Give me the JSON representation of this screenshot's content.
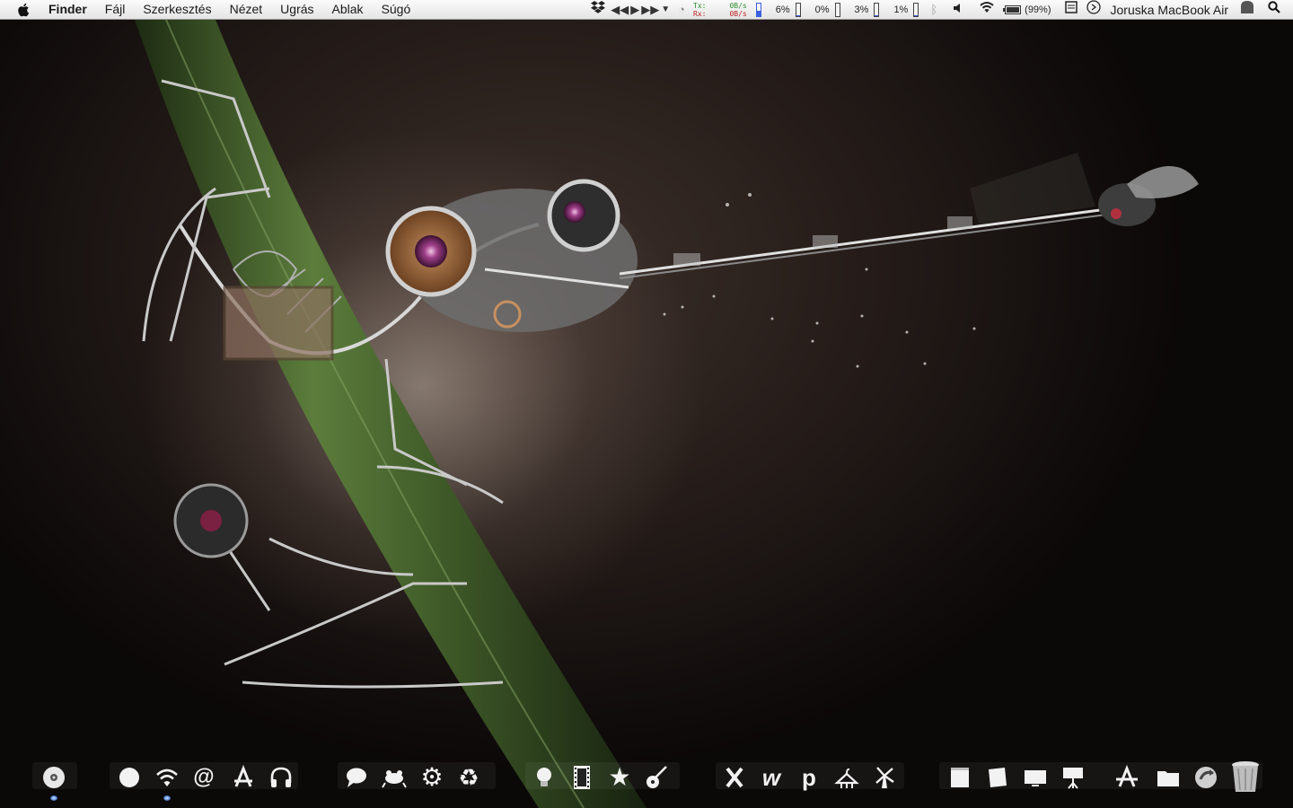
{
  "menubar": {
    "app_name": "Finder",
    "menus": [
      "Fájl",
      "Szerkesztés",
      "Nézet",
      "Ugrás",
      "Ablak",
      "Súgó"
    ],
    "status": {
      "tx_label": "Tx:",
      "rx_label": "Rx:",
      "tx_value": "0B/s",
      "rx_value": "0B/s",
      "meters": [
        {
          "label": "6%",
          "value": 0.06
        },
        {
          "label": "0%",
          "value": 0.0
        },
        {
          "label": "3%",
          "value": 0.03
        },
        {
          "label": "1%",
          "value": 0.01
        }
      ],
      "battery": "(99%)",
      "battery_level": 0.99,
      "user": "Joruska MacBook Air"
    },
    "icons": [
      "apple-icon",
      "dropbox-icon",
      "media-prev-icon",
      "media-play-icon",
      "media-next-icon",
      "media-menu-icon",
      "time-machine-icon",
      "bluetooth-icon",
      "volume-icon",
      "wifi-icon",
      "battery-icon",
      "keyboard-icon",
      "sync-icon",
      "user-icon",
      "spotlight-icon"
    ]
  },
  "dock": {
    "items": [
      {
        "name": "dvd-player-icon",
        "glyph": "◉",
        "running": true
      },
      {
        "name": "circle-app-icon",
        "glyph": "●",
        "running": false
      },
      {
        "name": "wifi-app-icon",
        "glyph": "wifi",
        "running": true
      },
      {
        "name": "mail-at-icon",
        "glyph": "@",
        "running": false
      },
      {
        "name": "app-store-icon",
        "glyph": "A",
        "running": false
      },
      {
        "name": "headphones-icon",
        "glyph": "🎧",
        "running": false
      },
      {
        "name": "chat-bubble-icon",
        "glyph": "bubble",
        "running": false
      },
      {
        "name": "frog-icon",
        "glyph": "frog",
        "running": false
      },
      {
        "name": "gear-icon",
        "glyph": "⚙",
        "running": false
      },
      {
        "name": "recycle-icon",
        "glyph": "♻",
        "running": false
      },
      {
        "name": "lightbulb-icon",
        "glyph": "bulb",
        "running": false
      },
      {
        "name": "film-strip-icon",
        "glyph": "film",
        "running": false
      },
      {
        "name": "star-icon",
        "glyph": "★",
        "running": false
      },
      {
        "name": "guitar-icon",
        "glyph": "guitar",
        "running": false
      },
      {
        "name": "bug-icon",
        "glyph": "bug",
        "running": false
      },
      {
        "name": "w-letter-icon",
        "glyph": "w",
        "running": false
      },
      {
        "name": "p-letter-icon",
        "glyph": "p",
        "running": false
      },
      {
        "name": "hanger-icon",
        "glyph": "hanger",
        "running": false
      },
      {
        "name": "windmill-icon",
        "glyph": "mill",
        "running": false
      },
      {
        "name": "notepad-icon",
        "glyph": "pad",
        "running": false
      },
      {
        "name": "sticky-note-icon",
        "glyph": "note",
        "running": false
      },
      {
        "name": "monitor-icon",
        "glyph": "screen",
        "running": false
      },
      {
        "name": "presentation-icon",
        "glyph": "pres",
        "running": false
      },
      {
        "name": "applications-folder-icon",
        "glyph": "A",
        "running": false
      },
      {
        "name": "folder-icon",
        "glyph": "folder",
        "running": false
      },
      {
        "name": "downloads-stack-icon",
        "glyph": "swirl",
        "running": false
      },
      {
        "name": "trash-icon",
        "glyph": "trash",
        "running": false
      }
    ]
  },
  "colors": {
    "menubar_top": "#fbfbfb",
    "menubar_bottom": "#e4e4e4",
    "stem_green": "#4e6f34",
    "tx_green": "#2a8a2a",
    "rx_red": "#c02020",
    "meter_blue": "#3a5fe0"
  }
}
